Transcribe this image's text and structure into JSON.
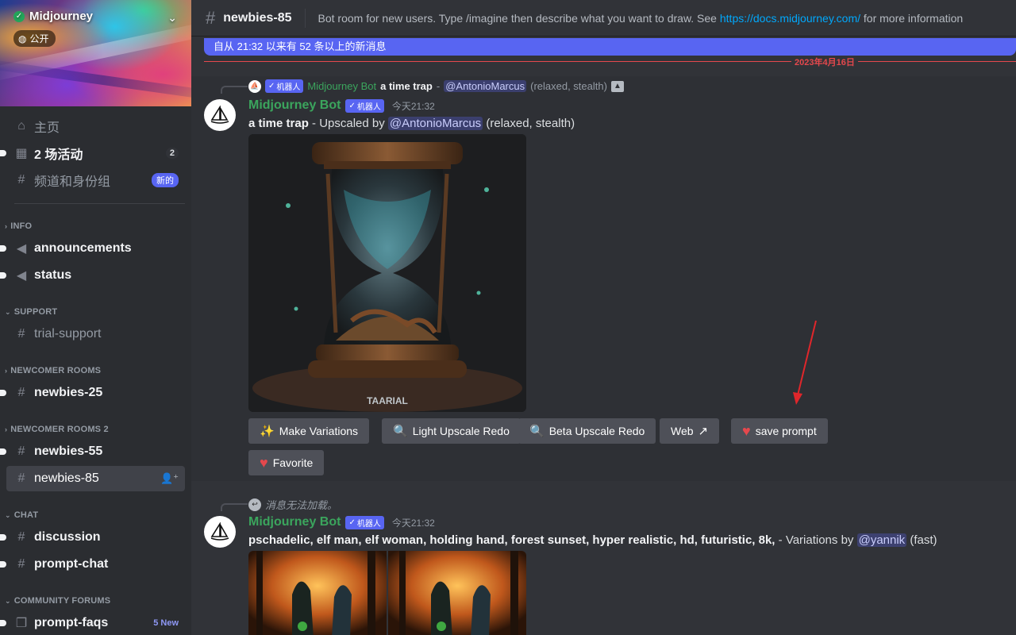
{
  "server": {
    "name": "Midjourney",
    "public_label": "公开"
  },
  "nav": {
    "home": "主页",
    "events": "2 场活动",
    "events_count": "2",
    "channels_roles": "频道和身份组",
    "new_badge": "新的"
  },
  "categories": {
    "info": "INFO",
    "support": "SUPPORT",
    "newcomer": "NEWCOMER ROOMS",
    "newcomer2": "NEWCOMER ROOMS 2",
    "chat": "CHAT",
    "forums": "COMMUNITY FORUMS"
  },
  "channels": {
    "announcements": "announcements",
    "status": "status",
    "trial_support": "trial-support",
    "newbies25": "newbies-25",
    "newbies55": "newbies-55",
    "newbies85": "newbies-85",
    "discussion": "discussion",
    "prompt_chat": "prompt-chat",
    "prompt_faqs": "prompt-faqs",
    "prompt_faqs_badge": "5 New"
  },
  "header": {
    "channel": "newbies-85",
    "topic_prefix": "Bot room for new users. Type /imagine then describe what you want to draw. See ",
    "topic_link": "https://docs.midjourney.com/",
    "topic_suffix": " for more information"
  },
  "new_messages_bar": "自从 21:32 以来有 52 条以上的新消息",
  "date_separator": "2023年4月16日",
  "message1": {
    "reply": {
      "bot_tag": "机器人",
      "author": "Midjourney Bot",
      "prompt": "a time trap",
      "dash": " - ",
      "mention": "@AntonioMarcus",
      "mode": "(relaxed, stealth)"
    },
    "author": "Midjourney Bot",
    "bot_tag": "机器人",
    "timestamp": "今天21:32",
    "prompt": "a time trap",
    "action": " - Upscaled by ",
    "mention": "@AntonioMarcus",
    "mode": " (relaxed, stealth)",
    "image_caption": "TAARIAL",
    "buttons": {
      "make_variations": "Make Variations",
      "light_upscale": "Light Upscale Redo",
      "beta_upscale": "Beta Upscale Redo",
      "web": "Web",
      "save_prompt": "save prompt",
      "favorite": "Favorite"
    }
  },
  "message2": {
    "reply_text": "消息无法加载。",
    "author": "Midjourney Bot",
    "bot_tag": "机器人",
    "timestamp": "今天21:32",
    "prompt": "pschadelic, elf man, elf woman, holding hand, forest sunset, hyper realistic, hd, futuristic, 8k,",
    "action": " - Variations by ",
    "mention": "@yannik",
    "mode": " (fast)"
  },
  "colors": {
    "accent": "#5865f2",
    "bot_green": "#3ba55d",
    "link": "#00a8fc",
    "alert_red": "#e5484d"
  }
}
